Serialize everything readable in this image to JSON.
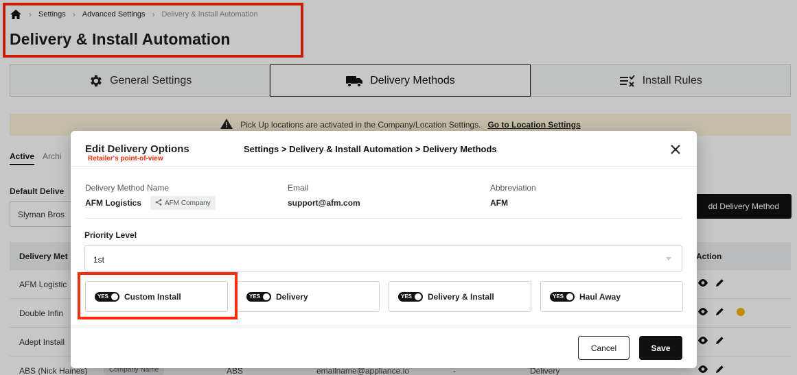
{
  "breadcrumb": {
    "items": [
      "Settings",
      "Advanced Settings"
    ],
    "current": "Delivery & Install Automation"
  },
  "page_title": "Delivery & Install Automation",
  "tabs": [
    {
      "label": "General Settings",
      "icon": "gear-icon"
    },
    {
      "label": "Delivery Methods",
      "icon": "truck-icon",
      "active": true
    },
    {
      "label": "Install Rules",
      "icon": "rules-icon"
    }
  ],
  "banner": {
    "text": "Pick Up locations are activated in the Company/Location Settings.",
    "link": "Go to Location Settings"
  },
  "subtabs": {
    "active": "Active",
    "other": "Archi"
  },
  "default_delivery": {
    "label": "Default Delive",
    "value": "Slyman Bros"
  },
  "add_button": "dd Delivery Method",
  "table": {
    "headers": {
      "name": "Delivery Met",
      "action": "Action"
    },
    "rows": [
      {
        "name": "AFM Logistic"
      },
      {
        "name": "Double Infin",
        "warning": true
      },
      {
        "name": "Adept Install"
      },
      {
        "name": "ABS (Nick Haines)",
        "company": "Company Name",
        "abbr": "ABS",
        "email": "emailname@appliance.io",
        "dash": "-",
        "type": "Delivery"
      }
    ]
  },
  "modal": {
    "title": "Edit Delivery Options",
    "note": "Retailer's point-of-view",
    "path": "Settings > Delivery & Install Automation > Delivery Methods",
    "fields": {
      "name_label": "Delivery Method Name",
      "name_value": "AFM Logistics",
      "company_chip": "AFM Company",
      "email_label": "Email",
      "email_value": "support@afm.com",
      "abbr_label": "Abbreviation",
      "abbr_value": "AFM"
    },
    "priority": {
      "label": "Priority Level",
      "value": "1st"
    },
    "options": [
      {
        "label": "Custom Install",
        "toggle": "YES"
      },
      {
        "label": "Delivery",
        "toggle": "YES"
      },
      {
        "label": "Delivery & Install",
        "toggle": "YES"
      },
      {
        "label": "Haul Away",
        "toggle": "YES"
      }
    ],
    "cancel": "Cancel",
    "save": "Save"
  },
  "colors": {
    "highlight": "#ff2a0a",
    "banner": "#fbf4d9",
    "primary": "#111111",
    "warning": "#f5b400"
  }
}
